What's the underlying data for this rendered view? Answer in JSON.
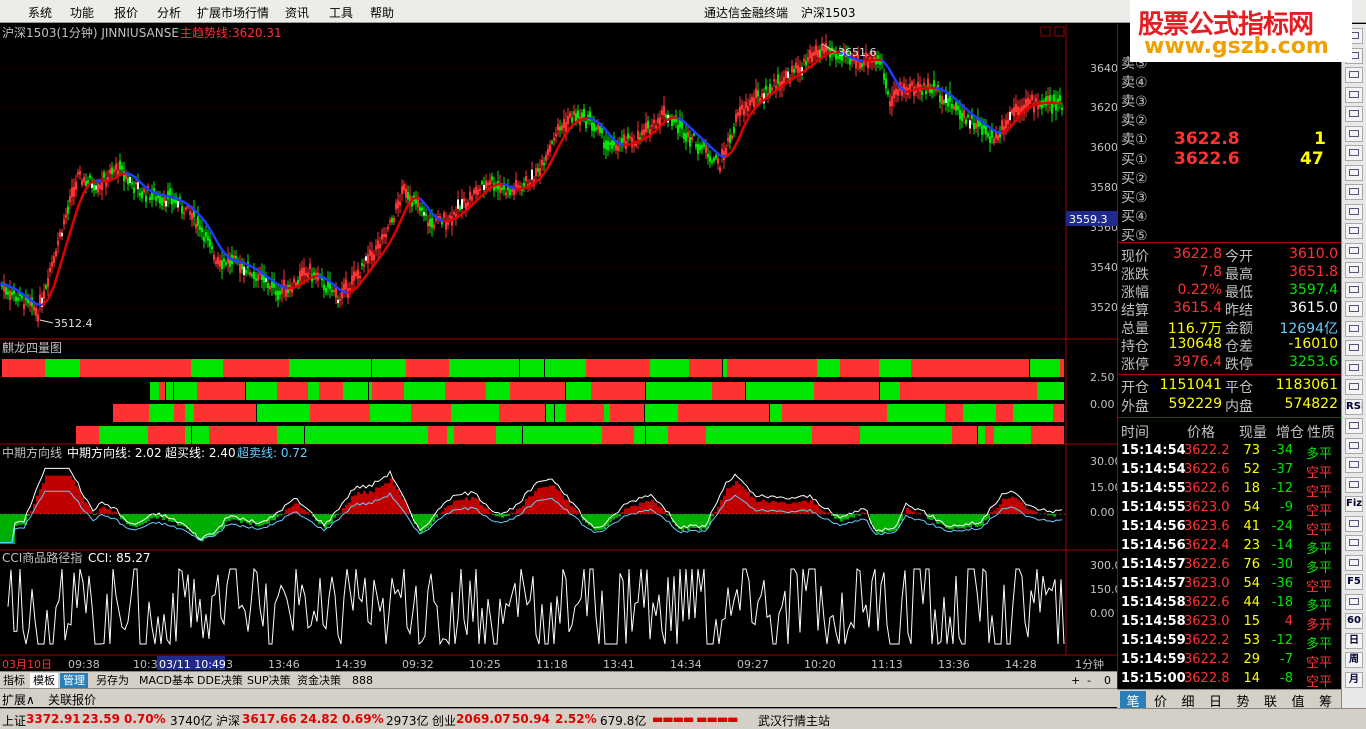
{
  "menu": [
    "系统",
    "功能",
    "报价",
    "分析",
    "扩展市场行情",
    "资讯",
    "工具",
    "帮助"
  ],
  "app_title": "通达信金融终端",
  "window_symbol": "沪深1503",
  "brand": {
    "name": "股票公式指标网",
    "url": "www.gszb.com"
  },
  "main_panel": {
    "title": "沪深1503(1分钟) JINNIUSANSE",
    "trend_label": "主趋势线:",
    "trend_value": "3620.31",
    "high_label": "3651.6",
    "low_label": "3512.4",
    "cursor_price": "3559.3",
    "y_ticks": [
      "3640",
      "3620",
      "3600",
      "3580",
      "3560",
      "3540",
      "3520"
    ]
  },
  "panel2": {
    "title": "麒龙四量图",
    "y_ticks": [
      "2.50",
      "0.00"
    ]
  },
  "panel3": {
    "title": "中期方向线",
    "line1": "中期方向线: 2.02",
    "line2": "超买线: 2.40",
    "line3": "超卖线: 0.72",
    "y_ticks": [
      "30.00",
      "15.00",
      "0.00"
    ]
  },
  "panel4": {
    "title": "CCI商品路径指",
    "value": "CCI: 85.27",
    "y_ticks": [
      "300.0",
      "150.0",
      "0.00"
    ]
  },
  "time_axis": {
    "start": "03月10日",
    "labels": [
      "09:38",
      "10:3",
      "03/11 10:49",
      "3",
      "13:46",
      "14:39",
      "09:32",
      "10:25",
      "11:18",
      "13:41",
      "14:34",
      "09:27",
      "10:20",
      "11:13",
      "13:36",
      "14:28"
    ],
    "period": "1分钟"
  },
  "orderbook": {
    "asks": [
      {
        "label": "卖⑤",
        "price": "",
        "vol": ""
      },
      {
        "label": "卖④",
        "price": "",
        "vol": ""
      },
      {
        "label": "卖③",
        "price": "",
        "vol": ""
      },
      {
        "label": "卖②",
        "price": "",
        "vol": ""
      },
      {
        "label": "卖①",
        "price": "3622.8",
        "vol": "1"
      }
    ],
    "bids": [
      {
        "label": "买①",
        "price": "3622.6",
        "vol": "47"
      },
      {
        "label": "买②",
        "price": "",
        "vol": ""
      },
      {
        "label": "买③",
        "price": "",
        "vol": ""
      },
      {
        "label": "买④",
        "price": "",
        "vol": ""
      },
      {
        "label": "买⑤",
        "price": "",
        "vol": ""
      }
    ]
  },
  "quote": [
    {
      "l1": "现价",
      "v1": "3622.8",
      "l2": "今开",
      "v2": "3610.0"
    },
    {
      "l1": "涨跌",
      "v1": "7.8",
      "l2": "最高",
      "v2": "3651.8"
    },
    {
      "l1": "涨幅",
      "v1": "0.22%",
      "l2": "最低",
      "v2": "3597.4"
    },
    {
      "l1": "结算",
      "v1": "3615.4",
      "l2": "昨结",
      "v2": "3615.0"
    },
    {
      "l1": "总量",
      "v1": "116.7万",
      "l2": "金额",
      "v2": "12694亿"
    },
    {
      "l1": "持仓",
      "v1": "130648",
      "l2": "仓差",
      "v2": "-16010"
    },
    {
      "l1": "涨停",
      "v1": "3976.4",
      "l2": "跌停",
      "v2": "3253.6"
    }
  ],
  "quote2": [
    {
      "l1": "开仓",
      "v1": "1151041",
      "l2": "平仓",
      "v2": "1183061"
    },
    {
      "l1": "外盘",
      "v1": "592229",
      "l2": "内盘",
      "v2": "574822"
    }
  ],
  "ticks_header": [
    "时间",
    "价格",
    "现量",
    "增仓",
    "性质"
  ],
  "ticks": [
    [
      "15:14:54",
      "3622.2",
      "73",
      "-34",
      "多平"
    ],
    [
      "15:14:54",
      "3622.6",
      "52",
      "-37",
      "空平"
    ],
    [
      "15:14:55",
      "3622.6",
      "18",
      "-12",
      "空平"
    ],
    [
      "15:14:55",
      "3623.0",
      "54",
      "-9",
      "空平"
    ],
    [
      "15:14:56",
      "3623.6",
      "41",
      "-24",
      "空平"
    ],
    [
      "15:14:56",
      "3622.4",
      "23",
      "-14",
      "多平"
    ],
    [
      "15:14:57",
      "3622.6",
      "76",
      "-30",
      "多平"
    ],
    [
      "15:14:57",
      "3623.0",
      "54",
      "-36",
      "空平"
    ],
    [
      "15:14:58",
      "3622.6",
      "44",
      "-18",
      "多平"
    ],
    [
      "15:14:58",
      "3623.0",
      "15",
      "4",
      "多开"
    ],
    [
      "15:14:59",
      "3622.2",
      "53",
      "-12",
      "多平"
    ],
    [
      "15:14:59",
      "3622.2",
      "29",
      "-7",
      "空平"
    ],
    [
      "15:15:00",
      "3622.8",
      "14",
      "-8",
      "空平"
    ]
  ],
  "bottom_tabs": [
    "指标",
    "模板",
    "管理",
    "另存为",
    "MACD基本",
    "DDE决策",
    "SUP决策",
    "资金决策",
    "888"
  ],
  "bottom_tabs2": [
    "扩展∧",
    "关联报价"
  ],
  "zoom_controls": [
    "+",
    "-",
    "0"
  ],
  "right_tabs": [
    "笔",
    "价",
    "细",
    "日",
    "势",
    "联",
    "值",
    "筹"
  ],
  "toolbar_icons": [
    "RSI",
    "Fiz",
    "F5",
    "60",
    "日",
    "周",
    "月"
  ],
  "status": {
    "sh_label": "上证",
    "sh_val": "3372.91",
    "sh_chg": "23.59",
    "sh_pct": "0.70%",
    "sh_amt": "3740亿",
    "hs_label": "沪深",
    "hs_val": "3617.66",
    "hs_chg": "24.82",
    "hs_pct": "0.69%",
    "hs_amt": "2973亿",
    "cy_label": "创业",
    "cy_val": "2069.07",
    "cy_chg": "50.94",
    "cy_pct": "2.52%",
    "cy_amt": "679.8亿",
    "server": "武汉行情主站"
  },
  "colors": {
    "up": "#ff3232",
    "down": "#00e600",
    "blue": "#1e3cff",
    "panelborder": "#a00000",
    "yellow": "#ffff00"
  }
}
